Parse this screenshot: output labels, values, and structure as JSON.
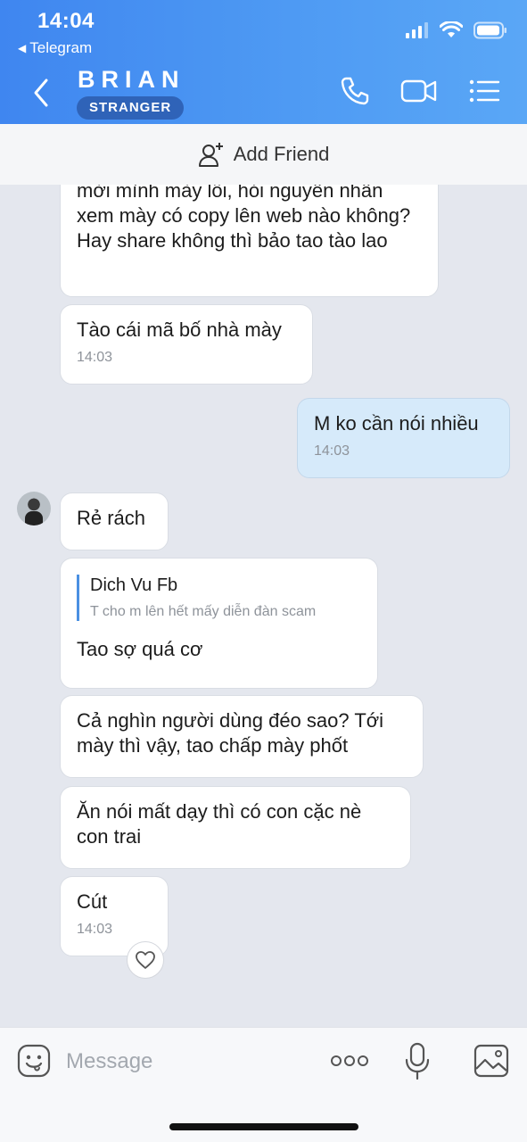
{
  "status_bar": {
    "time": "14:04",
    "back_app": "Telegram"
  },
  "header": {
    "name": "BRIAN",
    "badge": "STRANGER"
  },
  "add_friend": {
    "label": "Add Friend"
  },
  "messages": [
    {
      "side": "in",
      "text": "mời mình mày lỗi, hỏi nguyên nhân xem mày có copy lên web nào không? Hay share không thì bảo tao tào lao",
      "time": ""
    },
    {
      "side": "in",
      "text": "Tào cái mã bố nhà mày",
      "time": "14:03"
    },
    {
      "side": "out",
      "text": "M ko cần nói nhiều",
      "time": "14:03"
    },
    {
      "side": "in",
      "text": "Rẻ rách",
      "time": ""
    },
    {
      "side": "in",
      "reply_name": "Dich Vu Fb",
      "reply_text": "T cho m lên hết mấy diễn đàn scam",
      "text": "Tao sợ quá cơ",
      "time": ""
    },
    {
      "side": "in",
      "text": "Cả nghìn người dùng đéo sao? Tới mày thì vậy, tao chấp mày phốt",
      "time": ""
    },
    {
      "side": "in",
      "text": "Ăn nói mất dạy thì có con cặc nè con trai",
      "time": ""
    },
    {
      "side": "in",
      "text": "Cút",
      "time": "14:03"
    }
  ],
  "input": {
    "placeholder": "Message"
  },
  "colors": {
    "header": "#4a90ee",
    "badge": "#2f63b8",
    "outgoing_bubble": "#d6eafa",
    "chat_bg": "#e4e7ee"
  }
}
